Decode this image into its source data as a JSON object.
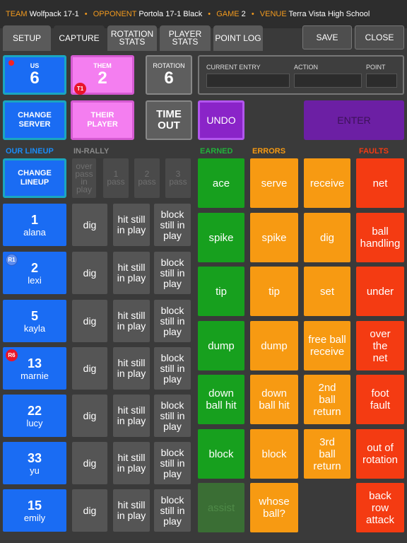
{
  "header": {
    "team_label": "TEAM",
    "team_value": "Wolfpack 17-1",
    "opponent_label": "OPPONENT",
    "opponent_value": "Portola 17-1 Black",
    "game_label": "GAME",
    "game_value": "2",
    "venue_label": "VENUE",
    "venue_value": "Terra Vista High School"
  },
  "tabs": [
    {
      "label": "SETUP"
    },
    {
      "label": "CAPTURE"
    },
    {
      "label": "ROTATION STATS"
    },
    {
      "label": "PLAYER STATS"
    },
    {
      "label": "POINT LOG"
    }
  ],
  "toolbar": {
    "save_label": "SAVE",
    "close_label": "CLOSE"
  },
  "scores": {
    "us_label": "US",
    "us_value": "6",
    "them_label": "THEM",
    "them_value": "2",
    "them_badge": "T1",
    "rotation_label": "ROTATION",
    "rotation_value": "6"
  },
  "entry": {
    "current_label": "CURRENT ENTRY",
    "action_label": "ACTION",
    "point_label": "POINT"
  },
  "controls": {
    "change_server": "CHANGE SERVER",
    "their_player": "THEIR PLAYER",
    "time_out": "TIME OUT",
    "undo": "UNDO",
    "enter": "ENTER"
  },
  "sections": {
    "our_lineup": "OUR LINEUP",
    "in_rally": "IN-RALLY",
    "earned": "EARNED",
    "errors": "ERRORS",
    "faults": "FAULTS"
  },
  "lineup_button": "CHANGE LINEUP",
  "pass_buttons": [
    "over pass in play",
    "1 pass",
    "2 pass",
    "3 pass"
  ],
  "players": [
    {
      "number": "1",
      "name": "alana",
      "badge": ""
    },
    {
      "number": "2",
      "name": "lexi",
      "badge": "R1"
    },
    {
      "number": "5",
      "name": "kayla",
      "badge": ""
    },
    {
      "number": "13",
      "name": "marnie",
      "badge": "R6"
    },
    {
      "number": "22",
      "name": "lucy",
      "badge": ""
    },
    {
      "number": "33",
      "name": "yu",
      "badge": ""
    },
    {
      "number": "15",
      "name": "emily",
      "badge": ""
    }
  ],
  "rally_actions": {
    "dig": "dig",
    "hit": "hit still in play",
    "block": "block still in play"
  },
  "earned": [
    "ace",
    "spike",
    "tip",
    "dump",
    "down ball hit",
    "block",
    "assist"
  ],
  "errors_col1": [
    "serve",
    "spike",
    "tip",
    "dump",
    "down ball hit",
    "block",
    "whose ball?"
  ],
  "errors_col2": [
    "receive",
    "dig",
    "set",
    "free ball receive",
    "2nd ball return",
    "3rd ball return"
  ],
  "faults": [
    "net",
    "ball handling",
    "under",
    "over the net",
    "foot fault",
    "out of rotation",
    "back row attack"
  ],
  "colors": {
    "blue": "#1a6cf3",
    "pink": "#f47ef0",
    "purple": "#8a24c8",
    "green": "#17a01e",
    "orange": "#f79a12",
    "red": "#f43b12",
    "accent": "#f29a1e"
  }
}
